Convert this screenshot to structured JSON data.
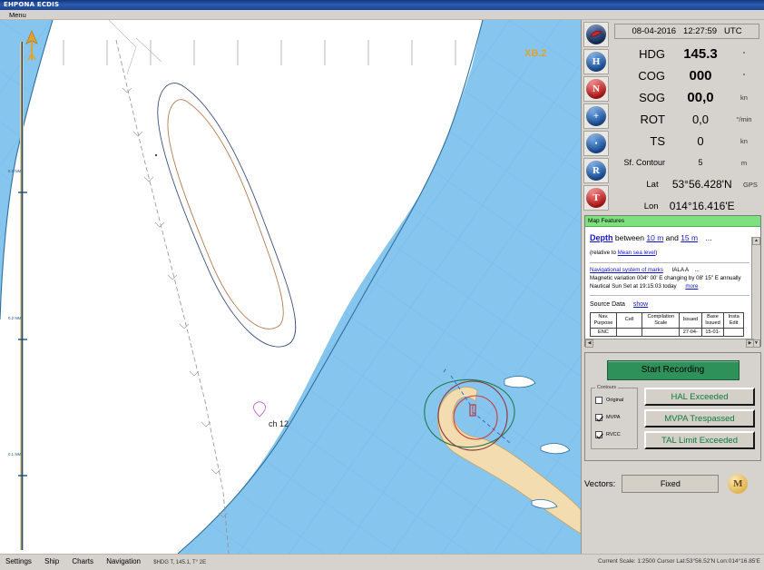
{
  "window": {
    "title": "EHPONA ECDIS"
  },
  "menubar": {
    "items": [
      "Menu"
    ]
  },
  "chart": {
    "cell_label": "XB.2",
    "calling_point_label": "ch 12",
    "scale_ticks": [
      "0.3 NM",
      "0.2 NM",
      "0.1 NM"
    ],
    "north_arrow": "north-arrow",
    "colors": {
      "sea": "#86c5ee",
      "land": "#ffffff",
      "shallow": "#f2dcb0",
      "depth_contour_blue": "#3a4f7a",
      "depth_contour_brown": "#b57a52",
      "mvpa": "#1d7a4a",
      "rvcc": "#8a3b3b",
      "ship": "#cc3333",
      "route": "#5b6fa8"
    }
  },
  "navdata": {
    "clock": {
      "date": "08-04-2016",
      "time": "12:27:59",
      "zone": "UTC"
    },
    "rows": [
      {
        "label": "HDG",
        "value": "145.3",
        "unit": "°"
      },
      {
        "label": "COG",
        "value": "000",
        "unit": "°"
      },
      {
        "label": "SOG",
        "value": "00,0",
        "unit": "kn"
      },
      {
        "label": "ROT",
        "value": "0,0",
        "unit": "°/min"
      },
      {
        "label": "TS",
        "value": "0",
        "unit": "kn"
      }
    ],
    "contour": {
      "label": "Sf. Contour",
      "value": "5",
      "unit": "m"
    },
    "position": {
      "lat_label": "Lat",
      "lat_value": "53°56.428'N",
      "lon_label": "Lon",
      "lon_value": "014°16.416'E",
      "source": "GPS"
    }
  },
  "iconrail": [
    {
      "name": "alarm-icon",
      "glyph": "",
      "style": "dark"
    },
    {
      "name": "heading-icon",
      "glyph": "H",
      "style": "blue"
    },
    {
      "name": "north-icon",
      "glyph": "N",
      "style": "red"
    },
    {
      "name": "zoom-in-icon",
      "glyph": "+",
      "style": "blue"
    },
    {
      "name": "sensors-icon",
      "glyph": "●",
      "style": "blue"
    },
    {
      "name": "route-icon",
      "glyph": "R",
      "style": "blue"
    },
    {
      "name": "target-icon",
      "glyph": "T",
      "style": "red"
    }
  ],
  "map_features": {
    "title": "Map Features",
    "depth_prefix": "Depth",
    "depth_text_1": " between ",
    "depth_min": "10 m",
    "depth_text_2": " and ",
    "depth_max": "15 m",
    "depth_more": "...",
    "relative_prefix": "(relative to ",
    "relative_link": "Mean sea level",
    "relative_suffix": ")",
    "nav_marks_link": "Navigational system of marks",
    "nav_marks_value": "IALA A",
    "nav_marks_more": "...",
    "magnetic_variation": "Magnetic variation 004° 00' E changing by 08' 15\" E annually",
    "sunset": "Nautical Sun Set at 19:15:03 today",
    "sunset_more": "more",
    "source_data_label": "Source Data",
    "source_data_link": "show",
    "table": {
      "headers": [
        "Nav. Purpose",
        "Cell",
        "Compilation Scale",
        "Issued",
        "Base Issued",
        "Insta Edit"
      ],
      "rows": [
        [
          "ENC",
          "",
          "",
          "27-04-",
          "15-01-",
          ""
        ]
      ]
    }
  },
  "controls": {
    "record_button": "Start Recording",
    "contours_legend": "Contours",
    "contours": [
      {
        "label": "Original",
        "checked": false
      },
      {
        "label": "MVPA",
        "checked": true
      },
      {
        "label": "RVCC",
        "checked": true
      }
    ],
    "alerts": [
      {
        "label": "HAL Exceeded"
      },
      {
        "label": "MVPA Trespassed"
      },
      {
        "label": "TAL Limit Exceeded"
      }
    ],
    "vectors_label": "Vectors:",
    "vectors_value": "Fixed",
    "badge": "M"
  },
  "statusbar": {
    "items": [
      "Settings",
      "Ship",
      "Charts",
      "Navigation"
    ],
    "nav_readout": "$HDG T, 145.1, T° 2E",
    "right": "Current Scale: 1:2500   Cursor Lat:53°56.52'N Lon:014°16.85'E"
  }
}
